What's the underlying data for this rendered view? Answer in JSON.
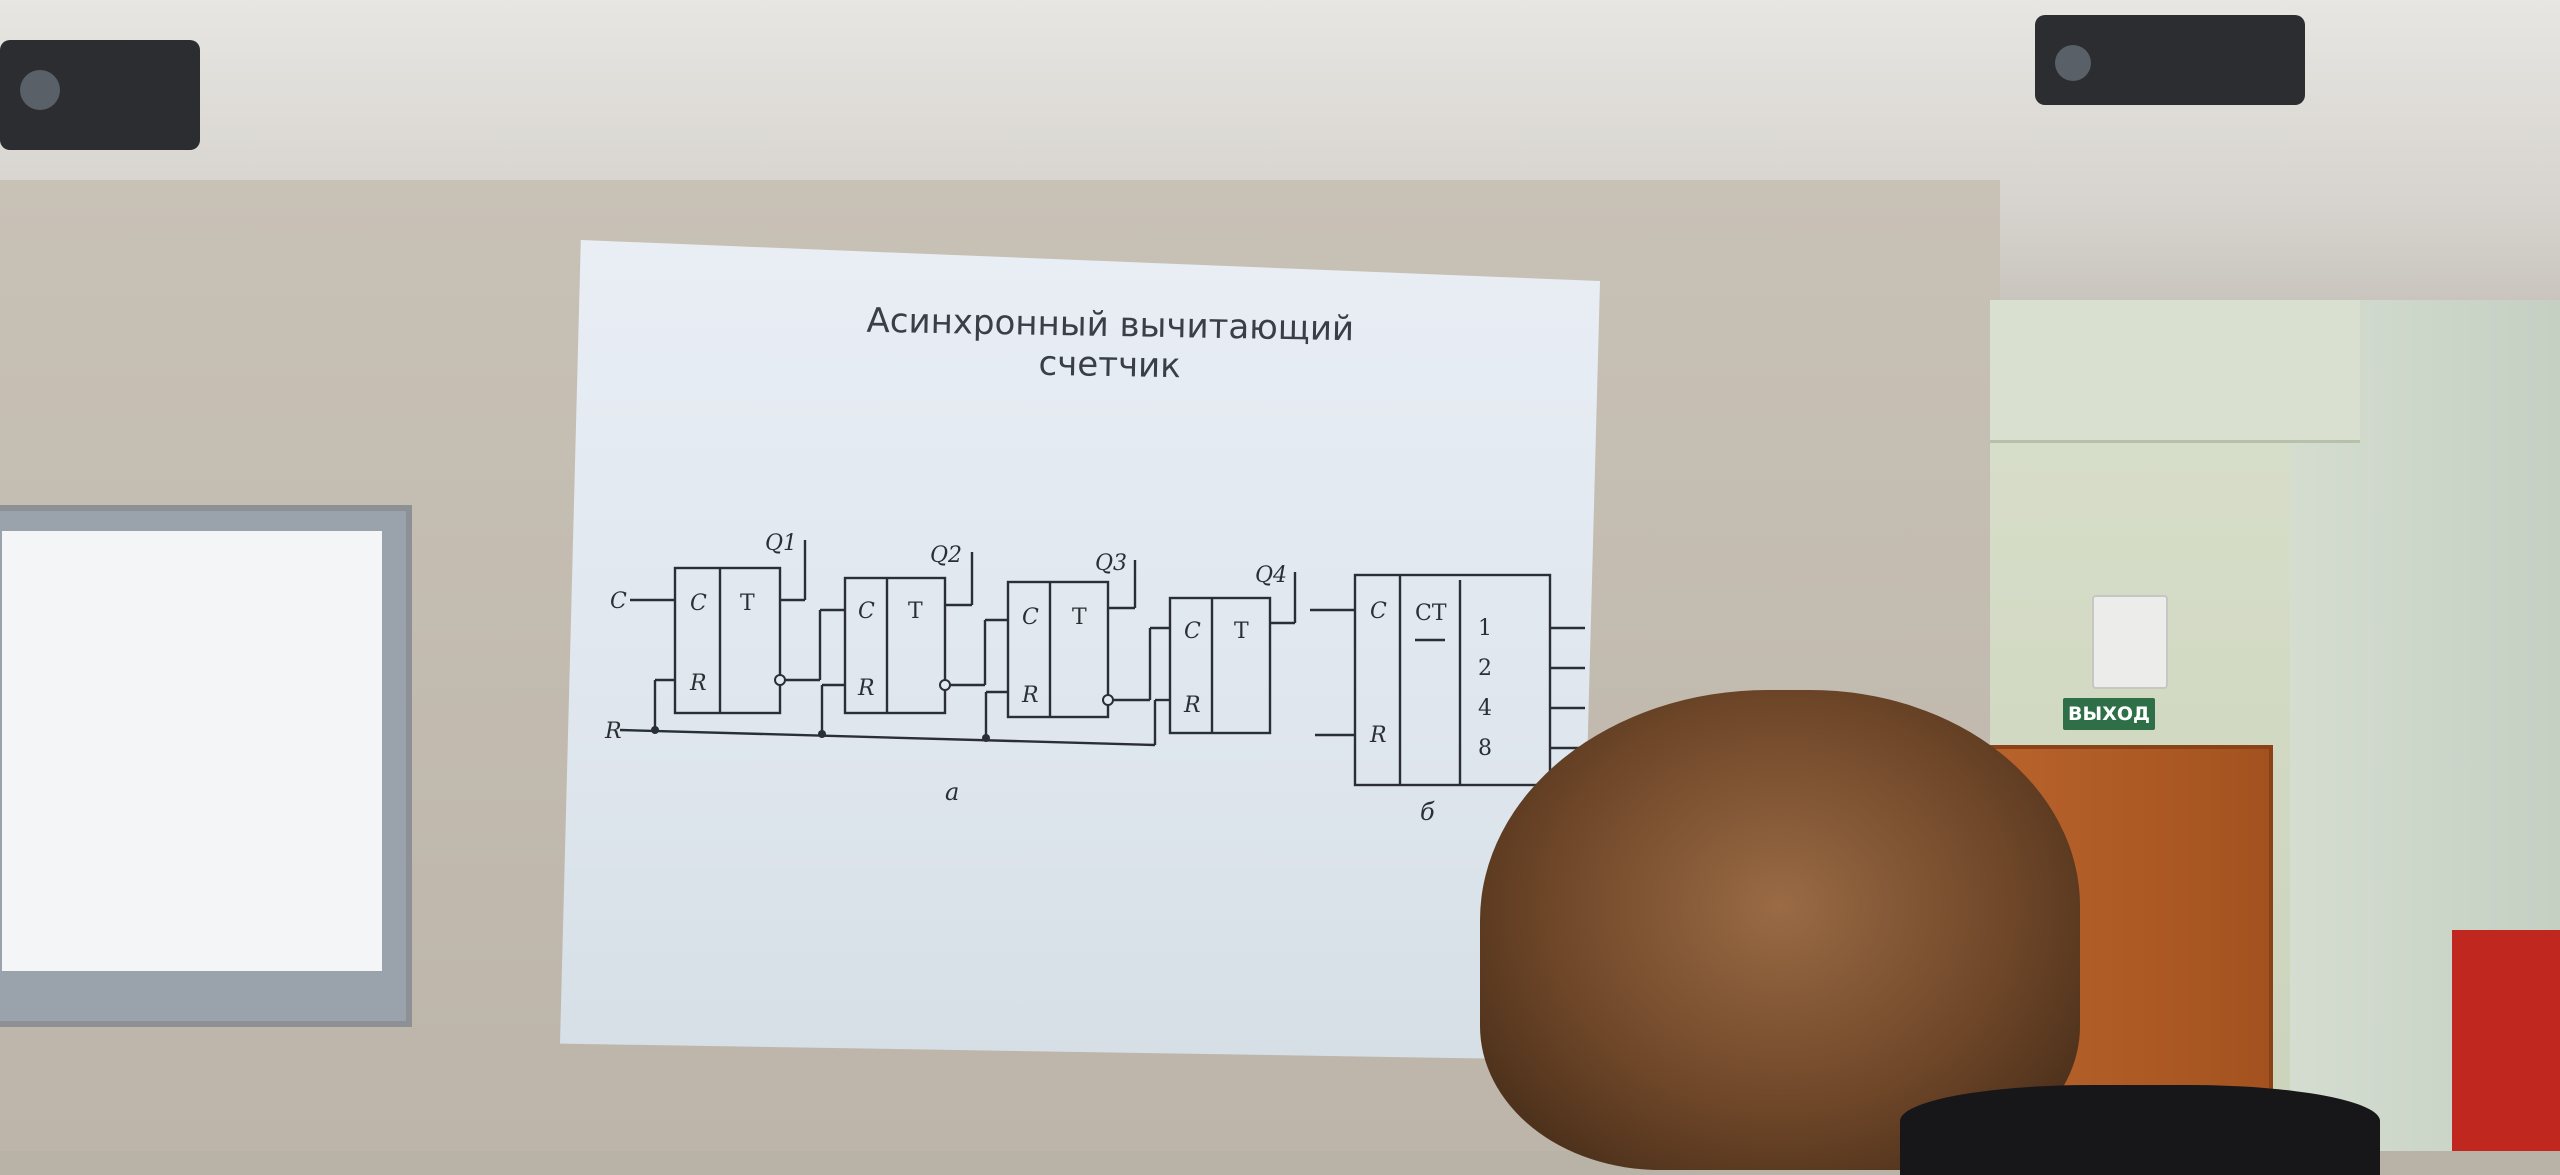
{
  "slide": {
    "title": "Асинхронный вычитающий счетчик",
    "diagram_a": {
      "caption": "а",
      "inputs": [
        "C",
        "R"
      ],
      "outputs": [
        "Q1",
        "Q2",
        "Q3",
        "Q4"
      ],
      "trigger_labels": [
        "C",
        "T",
        "R"
      ]
    },
    "diagram_b": {
      "caption": "б",
      "labels": [
        "C",
        "CT",
        "R"
      ],
      "outputs": [
        "1",
        "2",
        "4",
        "8"
      ]
    }
  },
  "room": {
    "exit_sign": "ВЫХОД"
  },
  "colors": {
    "screen": "#e3e9f0",
    "wall": "#c3bbb0",
    "door": "#ad5a25",
    "exit_sign": "#2e6f47",
    "hair": "#7b5132"
  }
}
